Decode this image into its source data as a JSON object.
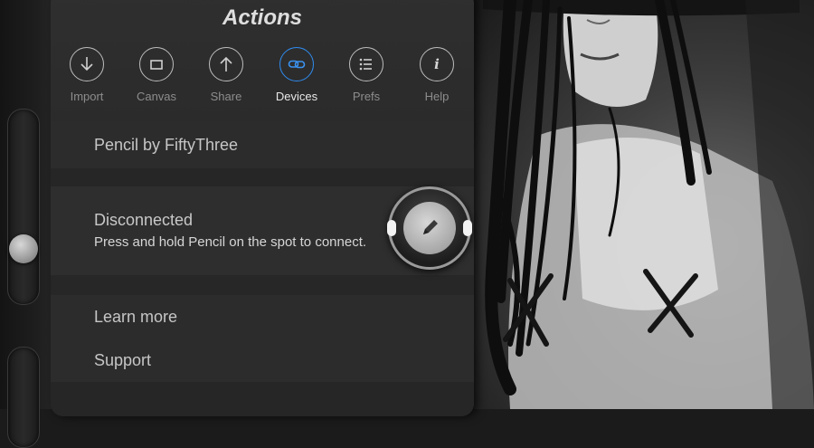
{
  "panel": {
    "title": "Actions",
    "tabs": [
      {
        "label": "Import",
        "icon": "import-arrow-icon",
        "active": false
      },
      {
        "label": "Canvas",
        "icon": "canvas-rect-icon",
        "active": false
      },
      {
        "label": "Share",
        "icon": "share-arrow-icon",
        "active": false
      },
      {
        "label": "Devices",
        "icon": "link-chain-icon",
        "active": true
      },
      {
        "label": "Prefs",
        "icon": "list-icon",
        "active": false
      },
      {
        "label": "Help",
        "icon": "info-icon",
        "active": false
      }
    ],
    "device_name": "Pencil by FiftyThree",
    "status_title": "Disconnected",
    "status_hint": "Press and hold Pencil on the spot to connect.",
    "learn_more": "Learn more",
    "support": "Support"
  },
  "colors": {
    "accent": "#2f8cf0",
    "panel_bg": "#2a2a2a",
    "text": "#c6c6c6"
  },
  "slider": {
    "level": 0.65
  }
}
